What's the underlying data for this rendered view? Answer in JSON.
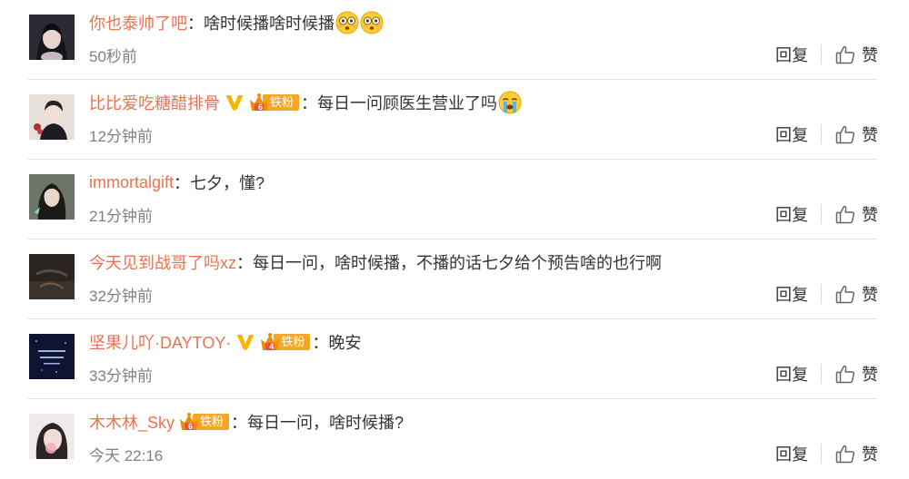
{
  "colors": {
    "username": "#eb7350",
    "text": "#333333",
    "time": "#808080",
    "badge": "#f5a623",
    "divider": "#e6e6e6"
  },
  "actions": {
    "reply_label": "回复",
    "like_label": "赞"
  },
  "comments": [
    {
      "username": "你也泰帅了吧",
      "separator": "：",
      "text": "啥时候播啥时候播",
      "emoji": [
        "flushed-face-icon",
        "flushed-face-icon"
      ],
      "time": "50秒前",
      "vip": false,
      "fan": null
    },
    {
      "username": "比比爱吃糖醋排骨",
      "separator": "：",
      "text": "每日一问顾医生营业了吗",
      "emoji": [
        "crying-face-icon"
      ],
      "time": "12分钟前",
      "vip": true,
      "fan": {
        "label": "铁粉",
        "level": "6"
      }
    },
    {
      "username": "immortalgift",
      "separator": "：",
      "text": "七夕，懂?",
      "emoji": [],
      "time": "21分钟前",
      "vip": false,
      "fan": null
    },
    {
      "username": "今天见到战哥了吗xz",
      "separator": "：",
      "text": "每日一问，啥时候播，不播的话七夕给个预告啥的也行啊",
      "emoji": [],
      "time": "32分钟前",
      "vip": false,
      "fan": null
    },
    {
      "username": "坚果儿吖·DAYTOY·",
      "separator": "：",
      "text": "晚安",
      "emoji": [],
      "time": "33分钟前",
      "vip": true,
      "fan": {
        "label": "铁粉",
        "level": "4"
      }
    },
    {
      "username": "木木林_Sky",
      "separator": "：",
      "text": "每日一问，啥时候播?",
      "emoji": [],
      "time": "今天 22:16",
      "vip": false,
      "fan": {
        "label": "铁粉",
        "level": "6"
      }
    }
  ]
}
